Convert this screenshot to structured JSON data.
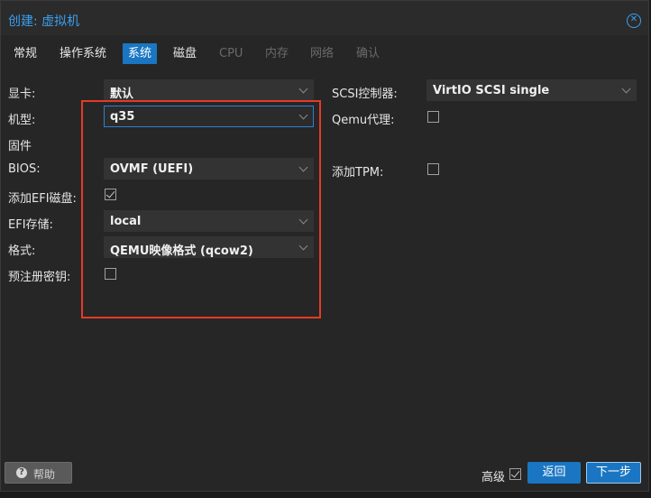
{
  "window": {
    "title": "创建: 虚拟机"
  },
  "tabs": [
    {
      "label": "常规",
      "state": "normal"
    },
    {
      "label": "操作系统",
      "state": "normal"
    },
    {
      "label": "系统",
      "state": "active"
    },
    {
      "label": "磁盘",
      "state": "normal"
    },
    {
      "label": "CPU",
      "state": "disabled"
    },
    {
      "label": "内存",
      "state": "disabled"
    },
    {
      "label": "网络",
      "state": "disabled"
    },
    {
      "label": "确认",
      "state": "disabled"
    }
  ],
  "left": {
    "graphics": {
      "label": "显卡:",
      "value": "默认"
    },
    "machine": {
      "label": "机型:",
      "value": "q35"
    },
    "firmware": {
      "label": "固件"
    },
    "bios": {
      "label": "BIOS:",
      "value": "OVMF (UEFI)"
    },
    "add_efi": {
      "label": "添加EFI磁盘:",
      "checked": true
    },
    "efi_storage": {
      "label": "EFI存储:",
      "value": "local"
    },
    "format": {
      "label": "格式:",
      "value": "QEMU映像格式 (qcow2)"
    },
    "pre_enroll": {
      "label": "预注册密钥:",
      "checked": false
    }
  },
  "right": {
    "scsi": {
      "label": "SCSI控制器:",
      "value": "VirtIO SCSI single"
    },
    "qemu_agent": {
      "label": "Qemu代理:",
      "checked": false
    },
    "add_tpm": {
      "label": "添加TPM:",
      "checked": false
    }
  },
  "footer": {
    "help": "帮助",
    "advanced": "高级",
    "advanced_checked": true,
    "back": "返回",
    "next": "下一步"
  },
  "colors": {
    "accent": "#1a76c2",
    "title": "#3aa0f0",
    "highlight_box": "#e53a26"
  }
}
